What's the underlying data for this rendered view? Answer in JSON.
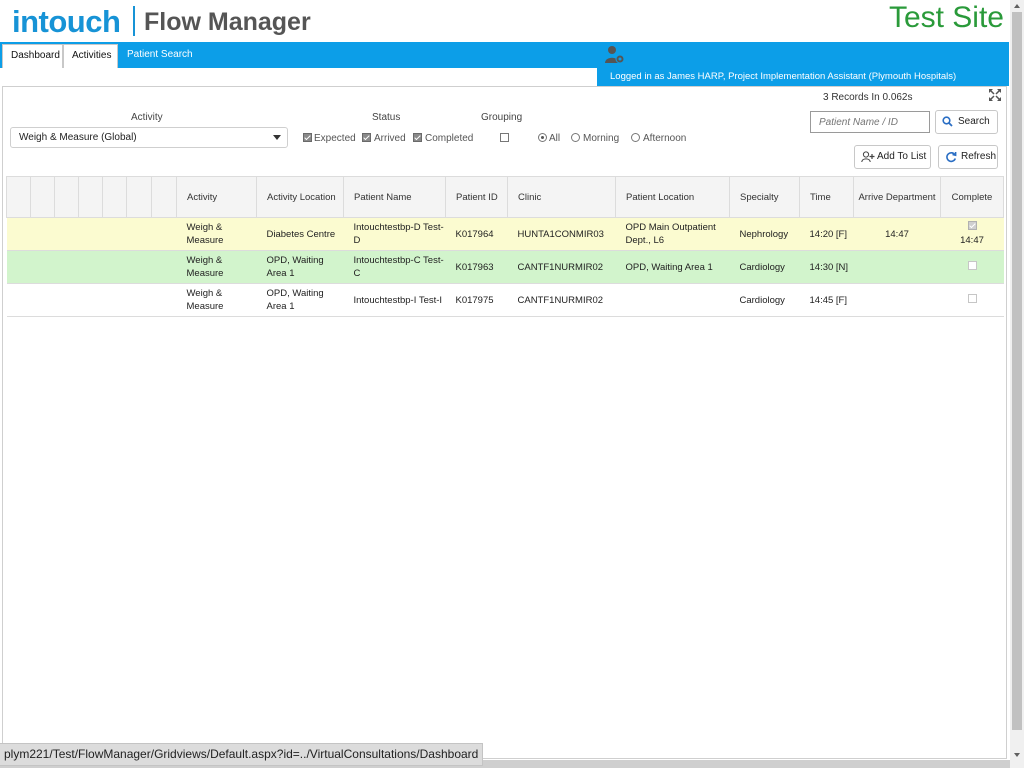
{
  "header": {
    "brand": "intouch",
    "app_title": "Flow Manager",
    "site_label": "Test Site"
  },
  "nav": {
    "tabs": [
      {
        "label": "Dashboard"
      },
      {
        "label": "Activities"
      },
      {
        "label": "Patient Search"
      }
    ],
    "user_text": "Logged in as James HARP, Project Implementation Assistant (Plymouth Hospitals)"
  },
  "toolbar": {
    "records_text": "3 Records In 0.062s",
    "search_placeholder": "Patient Name / ID",
    "search_label": "Search",
    "add_to_list_label": "Add To List",
    "refresh_label": "Refresh"
  },
  "filters": {
    "activity_label": "Activity",
    "activity_value": "Weigh & Measure (Global)",
    "status_label": "Status",
    "status_options": [
      {
        "label": "Expected",
        "checked": true
      },
      {
        "label": "Arrived",
        "checked": true
      },
      {
        "label": "Completed",
        "checked": true
      }
    ],
    "grouping_label": "Grouping",
    "grouping_checked": false,
    "grouping_options": [
      {
        "label": "All",
        "selected": true
      },
      {
        "label": "Morning",
        "selected": false
      },
      {
        "label": "Afternoon",
        "selected": false
      }
    ]
  },
  "grid": {
    "columns": [
      "Activity",
      "Activity Location",
      "Patient Name",
      "Patient ID",
      "Clinic",
      "Patient Location",
      "Specialty",
      "Time",
      "Arrive Department",
      "Complete"
    ],
    "rows": [
      {
        "status": "arrived",
        "activity": "Weigh & Measure",
        "activity_location": "Diabetes Centre",
        "patient_name": "Intouchtestbp-D Test-D",
        "patient_id": "K017964",
        "clinic": "HUNTA1CONMIR03",
        "patient_location": "OPD Main Outpatient Dept., L6",
        "specialty": "Nephrology",
        "time": "14:20 [F]",
        "arrive_department": "14:47",
        "complete_checked": true,
        "complete_time": "14:47"
      },
      {
        "status": "in-location",
        "activity": "Weigh & Measure",
        "activity_location": "OPD, Waiting Area 1",
        "patient_name": "Intouchtestbp-C Test-C",
        "patient_id": "K017963",
        "clinic": "CANTF1NURMIR02",
        "patient_location": "OPD, Waiting Area 1",
        "specialty": "Cardiology",
        "time": "14:30 [N]",
        "arrive_department": "",
        "complete_checked": false,
        "complete_time": ""
      },
      {
        "status": "expected",
        "activity": "Weigh & Measure",
        "activity_location": "OPD, Waiting Area 1",
        "patient_name": "Intouchtestbp-I Test-I",
        "patient_id": "K017975",
        "clinic": "CANTF1NURMIR02",
        "patient_location": "",
        "specialty": "Cardiology",
        "time": "14:45 [F]",
        "arrive_department": "",
        "complete_checked": false,
        "complete_time": ""
      }
    ]
  },
  "status_bar": {
    "url": "plym221/Test/FlowManager/Gridviews/Default.aspx?id=../VirtualConsultations/Dashboard"
  },
  "colors": {
    "brand_blue": "#1793d6",
    "nav_blue": "#0c9ee8",
    "site_green": "#2a9a3a",
    "row_arrived": "#fbfbd0",
    "row_in_location": "#d2f4cc"
  },
  "icons": {
    "user": "user-gear-icon",
    "expand": "expand-icon",
    "search": "search-icon",
    "add": "add-user-icon",
    "refresh": "refresh-icon"
  }
}
